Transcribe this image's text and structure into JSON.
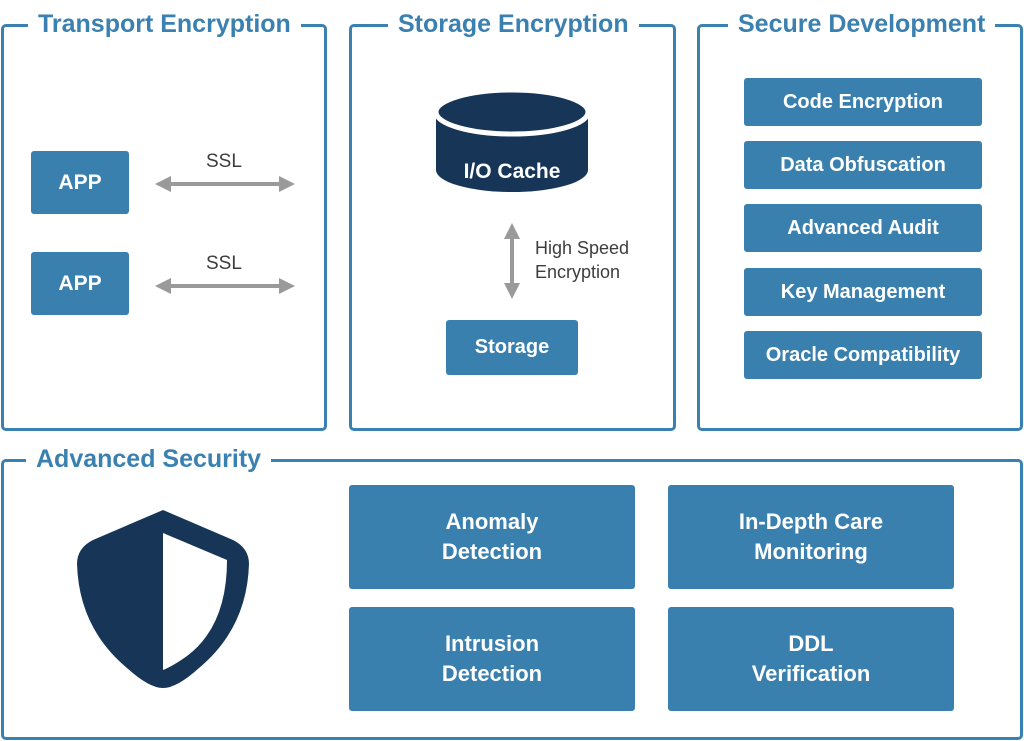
{
  "colors": {
    "panel_border": "#3a80b0",
    "box_fill": "#3a80af",
    "dark_navy": "#173556",
    "arrow_gray": "#9a9a9a",
    "label_text": "#3d3d3d"
  },
  "transport": {
    "title": "Transport Encryption",
    "apps": [
      {
        "label": "APP",
        "link_label": "SSL"
      },
      {
        "label": "APP",
        "link_label": "SSL"
      }
    ]
  },
  "storage": {
    "title": "Storage Encryption",
    "cache_label": "I/O Cache",
    "arrow_label_line1": "High Speed",
    "arrow_label_line2": "Encryption",
    "storage_label": "Storage"
  },
  "secure_dev": {
    "title": "Secure Development",
    "items": [
      "Code Encryption",
      "Data Obfuscation",
      "Advanced Audit",
      "Key Management",
      "Oracle Compatibility"
    ]
  },
  "advanced": {
    "title": "Advanced Security",
    "icon": "shield-icon",
    "items": [
      {
        "line1": "Anomaly",
        "line2": "Detection"
      },
      {
        "line1": "In-Depth Care",
        "line2": "Monitoring"
      },
      {
        "line1": "Intrusion",
        "line2": "Detection"
      },
      {
        "line1": "DDL",
        "line2": "Verification"
      }
    ]
  }
}
